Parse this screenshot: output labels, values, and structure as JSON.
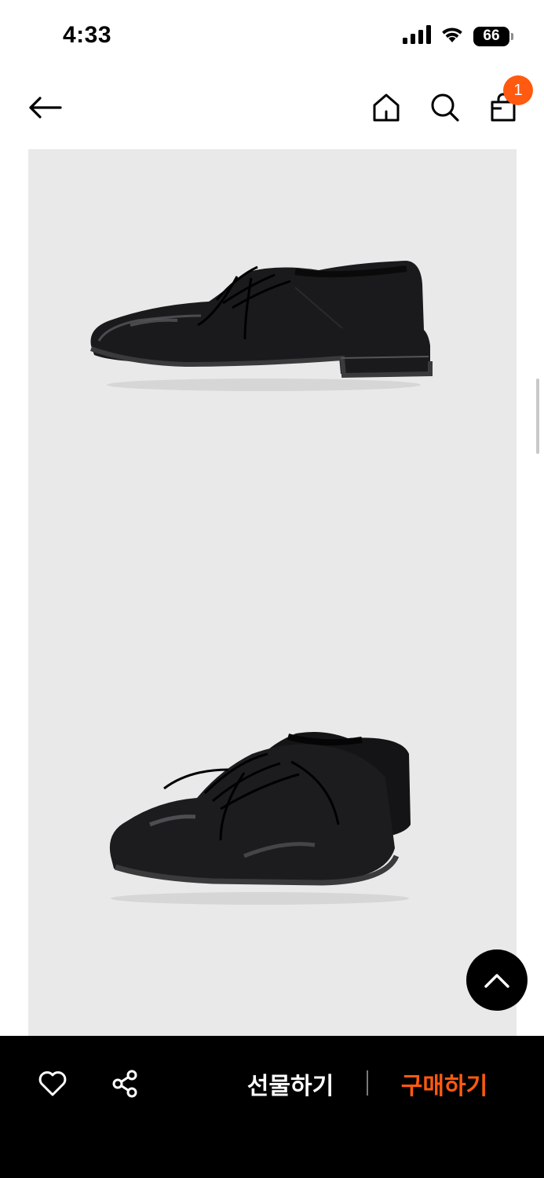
{
  "status_bar": {
    "time": "4:33",
    "battery": "66",
    "icons": [
      "signal-icon",
      "wifi-icon",
      "battery-icon"
    ]
  },
  "header": {
    "back_icon": "arrow-left-icon",
    "home_icon": "home-icon",
    "search_icon": "search-icon",
    "cart_icon": "shopping-bag-icon",
    "cart_count": "1"
  },
  "gallery": {
    "images": [
      "shoe-side-view",
      "shoe-pair-view"
    ]
  },
  "bottom_bar": {
    "wish_icon": "heart-icon",
    "share_icon": "share-icon",
    "gift_label": "선물하기",
    "buy_label": "구매하기"
  },
  "colors": {
    "accent": "#ff5a10",
    "background": "#ffffff",
    "gallery_bg": "#e9e9ea",
    "bar_bg": "#000000"
  }
}
